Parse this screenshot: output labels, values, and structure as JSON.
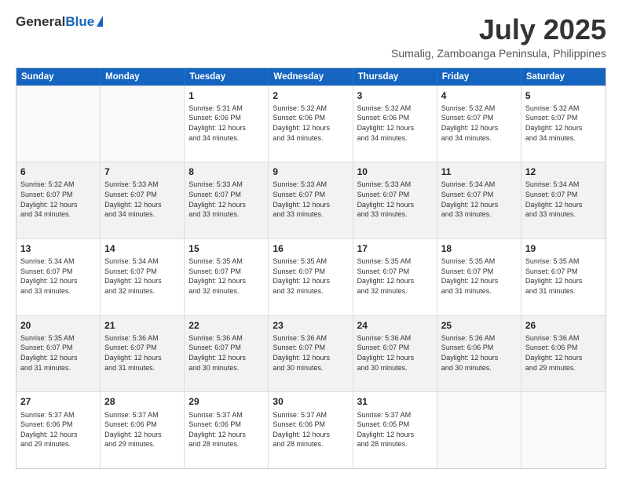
{
  "logo": {
    "general": "General",
    "blue": "Blue"
  },
  "title": "July 2025",
  "subtitle": "Sumalig, Zamboanga Peninsula, Philippines",
  "header_days": [
    "Sunday",
    "Monday",
    "Tuesday",
    "Wednesday",
    "Thursday",
    "Friday",
    "Saturday"
  ],
  "weeks": [
    {
      "cells": [
        {
          "day": "",
          "lines": [],
          "empty": true
        },
        {
          "day": "",
          "lines": [],
          "empty": true
        },
        {
          "day": "1",
          "lines": [
            "Sunrise: 5:31 AM",
            "Sunset: 6:06 PM",
            "Daylight: 12 hours",
            "and 34 minutes."
          ]
        },
        {
          "day": "2",
          "lines": [
            "Sunrise: 5:32 AM",
            "Sunset: 6:06 PM",
            "Daylight: 12 hours",
            "and 34 minutes."
          ]
        },
        {
          "day": "3",
          "lines": [
            "Sunrise: 5:32 AM",
            "Sunset: 6:06 PM",
            "Daylight: 12 hours",
            "and 34 minutes."
          ]
        },
        {
          "day": "4",
          "lines": [
            "Sunrise: 5:32 AM",
            "Sunset: 6:07 PM",
            "Daylight: 12 hours",
            "and 34 minutes."
          ]
        },
        {
          "day": "5",
          "lines": [
            "Sunrise: 5:32 AM",
            "Sunset: 6:07 PM",
            "Daylight: 12 hours",
            "and 34 minutes."
          ]
        }
      ]
    },
    {
      "cells": [
        {
          "day": "6",
          "lines": [
            "Sunrise: 5:32 AM",
            "Sunset: 6:07 PM",
            "Daylight: 12 hours",
            "and 34 minutes."
          ]
        },
        {
          "day": "7",
          "lines": [
            "Sunrise: 5:33 AM",
            "Sunset: 6:07 PM",
            "Daylight: 12 hours",
            "and 34 minutes."
          ]
        },
        {
          "day": "8",
          "lines": [
            "Sunrise: 5:33 AM",
            "Sunset: 6:07 PM",
            "Daylight: 12 hours",
            "and 33 minutes."
          ]
        },
        {
          "day": "9",
          "lines": [
            "Sunrise: 5:33 AM",
            "Sunset: 6:07 PM",
            "Daylight: 12 hours",
            "and 33 minutes."
          ]
        },
        {
          "day": "10",
          "lines": [
            "Sunrise: 5:33 AM",
            "Sunset: 6:07 PM",
            "Daylight: 12 hours",
            "and 33 minutes."
          ]
        },
        {
          "day": "11",
          "lines": [
            "Sunrise: 5:34 AM",
            "Sunset: 6:07 PM",
            "Daylight: 12 hours",
            "and 33 minutes."
          ]
        },
        {
          "day": "12",
          "lines": [
            "Sunrise: 5:34 AM",
            "Sunset: 6:07 PM",
            "Daylight: 12 hours",
            "and 33 minutes."
          ]
        }
      ]
    },
    {
      "cells": [
        {
          "day": "13",
          "lines": [
            "Sunrise: 5:34 AM",
            "Sunset: 6:07 PM",
            "Daylight: 12 hours",
            "and 33 minutes."
          ]
        },
        {
          "day": "14",
          "lines": [
            "Sunrise: 5:34 AM",
            "Sunset: 6:07 PM",
            "Daylight: 12 hours",
            "and 32 minutes."
          ]
        },
        {
          "day": "15",
          "lines": [
            "Sunrise: 5:35 AM",
            "Sunset: 6:07 PM",
            "Daylight: 12 hours",
            "and 32 minutes."
          ]
        },
        {
          "day": "16",
          "lines": [
            "Sunrise: 5:35 AM",
            "Sunset: 6:07 PM",
            "Daylight: 12 hours",
            "and 32 minutes."
          ]
        },
        {
          "day": "17",
          "lines": [
            "Sunrise: 5:35 AM",
            "Sunset: 6:07 PM",
            "Daylight: 12 hours",
            "and 32 minutes."
          ]
        },
        {
          "day": "18",
          "lines": [
            "Sunrise: 5:35 AM",
            "Sunset: 6:07 PM",
            "Daylight: 12 hours",
            "and 31 minutes."
          ]
        },
        {
          "day": "19",
          "lines": [
            "Sunrise: 5:35 AM",
            "Sunset: 6:07 PM",
            "Daylight: 12 hours",
            "and 31 minutes."
          ]
        }
      ]
    },
    {
      "cells": [
        {
          "day": "20",
          "lines": [
            "Sunrise: 5:35 AM",
            "Sunset: 6:07 PM",
            "Daylight: 12 hours",
            "and 31 minutes."
          ]
        },
        {
          "day": "21",
          "lines": [
            "Sunrise: 5:36 AM",
            "Sunset: 6:07 PM",
            "Daylight: 12 hours",
            "and 31 minutes."
          ]
        },
        {
          "day": "22",
          "lines": [
            "Sunrise: 5:36 AM",
            "Sunset: 6:07 PM",
            "Daylight: 12 hours",
            "and 30 minutes."
          ]
        },
        {
          "day": "23",
          "lines": [
            "Sunrise: 5:36 AM",
            "Sunset: 6:07 PM",
            "Daylight: 12 hours",
            "and 30 minutes."
          ]
        },
        {
          "day": "24",
          "lines": [
            "Sunrise: 5:36 AM",
            "Sunset: 6:07 PM",
            "Daylight: 12 hours",
            "and 30 minutes."
          ]
        },
        {
          "day": "25",
          "lines": [
            "Sunrise: 5:36 AM",
            "Sunset: 6:06 PM",
            "Daylight: 12 hours",
            "and 30 minutes."
          ]
        },
        {
          "day": "26",
          "lines": [
            "Sunrise: 5:36 AM",
            "Sunset: 6:06 PM",
            "Daylight: 12 hours",
            "and 29 minutes."
          ]
        }
      ]
    },
    {
      "cells": [
        {
          "day": "27",
          "lines": [
            "Sunrise: 5:37 AM",
            "Sunset: 6:06 PM",
            "Daylight: 12 hours",
            "and 29 minutes."
          ]
        },
        {
          "day": "28",
          "lines": [
            "Sunrise: 5:37 AM",
            "Sunset: 6:06 PM",
            "Daylight: 12 hours",
            "and 29 minutes."
          ]
        },
        {
          "day": "29",
          "lines": [
            "Sunrise: 5:37 AM",
            "Sunset: 6:06 PM",
            "Daylight: 12 hours",
            "and 28 minutes."
          ]
        },
        {
          "day": "30",
          "lines": [
            "Sunrise: 5:37 AM",
            "Sunset: 6:06 PM",
            "Daylight: 12 hours",
            "and 28 minutes."
          ]
        },
        {
          "day": "31",
          "lines": [
            "Sunrise: 5:37 AM",
            "Sunset: 6:05 PM",
            "Daylight: 12 hours",
            "and 28 minutes."
          ]
        },
        {
          "day": "",
          "lines": [],
          "empty": true
        },
        {
          "day": "",
          "lines": [],
          "empty": true
        }
      ]
    }
  ]
}
